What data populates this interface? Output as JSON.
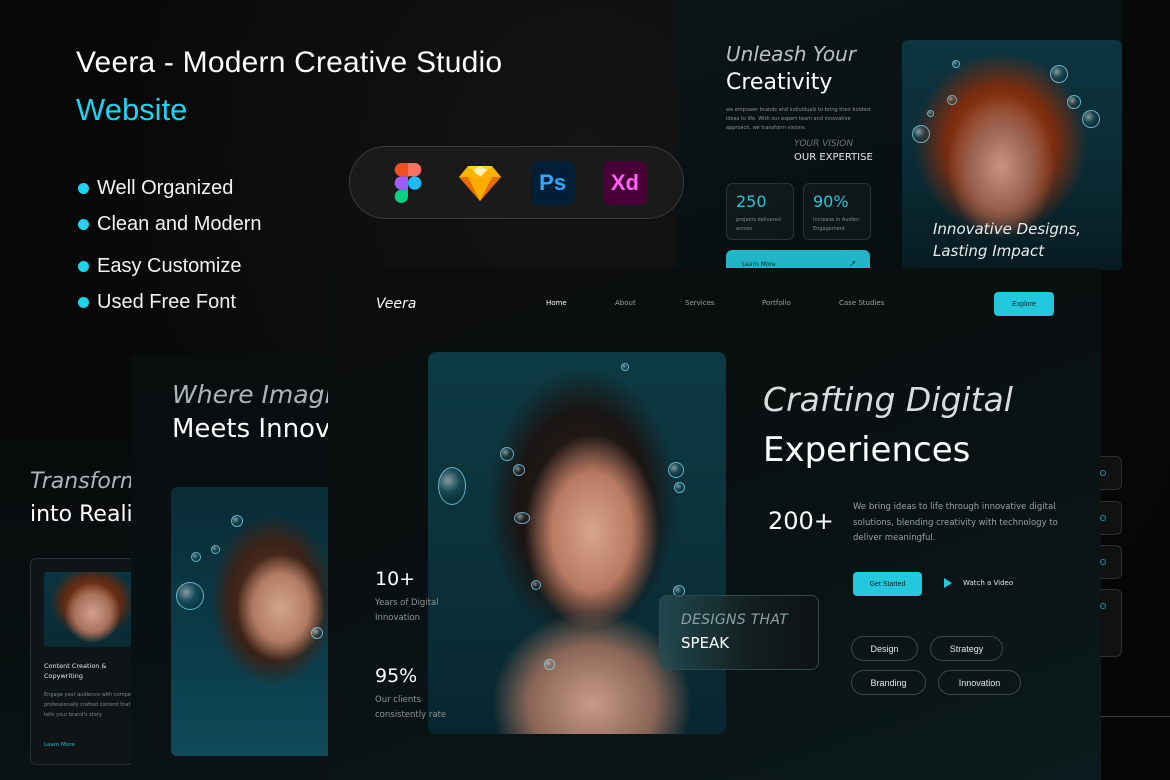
{
  "promo": {
    "title": "Veera - Modern Creative Studio",
    "subtitle": "Website",
    "features": [
      "Well Organized",
      "Clean and Modern",
      "Easy Customize",
      "Used Free Font"
    ],
    "tools": [
      {
        "name": "Figma",
        "icon": "figma-icon"
      },
      {
        "name": "Sketch",
        "icon": "sketch-icon"
      },
      {
        "name": "Photoshop",
        "label": "Ps",
        "icon": "photoshop-icon"
      },
      {
        "name": "Adobe XD",
        "label": "Xd",
        "icon": "adobe-xd-icon"
      }
    ],
    "accent_color": "#1fd3ee"
  },
  "preview_top_right": {
    "italic_heading": "Unleash Your",
    "heading": "Creativity",
    "body": "we empower brands and individuals to bring their boldest ideas to life. With our expert team and innovative approach, we transform visions.",
    "vision_label": "YOUR VISION",
    "expertise_label": "OUR EXPERTISE",
    "stats": [
      {
        "value": "250",
        "label": "projects delivered across"
      },
      {
        "value": "90%",
        "label": "Increase in Audien Engagement"
      }
    ],
    "learn_more": "Learn More",
    "learn_more_arrow": "↗",
    "photo_caption_line1": "Innovative Designs,",
    "photo_caption_line2": "Lasting Impact"
  },
  "main_site": {
    "logo": "Veera",
    "nav": [
      "Home",
      "About",
      "Services",
      "Portfolio",
      "Case Studies"
    ],
    "active_nav": "Home",
    "explore_button": "Explore",
    "stats": [
      {
        "value": "10+",
        "label_line1": "Years of Digital",
        "label_line2": "Innovation"
      },
      {
        "value": "95%",
        "label_line1": "Our clients",
        "label_line2": "consistently rate"
      }
    ],
    "overlay_card": {
      "line1": "DESIGNS THAT",
      "line2": "SPEAK"
    },
    "hero_italic": "Crafting Digital",
    "hero_title": "Experiences",
    "count": "200+",
    "description": "We bring ideas to life through innovative digital solutions, blending creativity with technology to deliver meaningful.",
    "get_started": "Get Started",
    "watch_video": "Watch a Video",
    "tags": [
      "Design",
      "Strategy",
      "Branding",
      "Innovation"
    ],
    "accent_color": "#22c9dc"
  },
  "preview_mid_left": {
    "italic_heading": "Where Imagination",
    "heading": "Meets Innovation"
  },
  "preview_far_left": {
    "italic_heading": "Transform",
    "heading": "into Reality",
    "card": {
      "title": "Content Creation & Copywriting",
      "body_lines": [
        "Engage your audience with compelling,",
        "professionally crafted content that",
        "tells your brand's story."
      ],
      "link": "Learn More"
    }
  }
}
